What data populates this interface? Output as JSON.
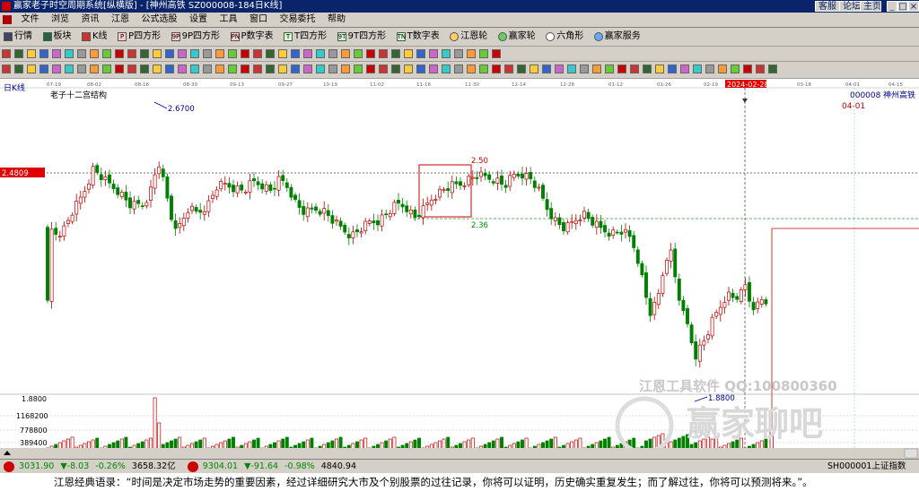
{
  "titlebar": {
    "title": "赢家老子时空周期系统[纵横版] - [神州高铁  SZ000008-184日K线]",
    "buttons": [
      "客服",
      "论坛",
      "主页"
    ],
    "win_controls": [
      "_",
      "□",
      "×"
    ]
  },
  "menu": [
    "文件",
    "浏览",
    "资讯",
    "江恩",
    "公式选股",
    "设置",
    "工具",
    "窗口",
    "交易委托",
    "帮助"
  ],
  "toolbar1": [
    {
      "icon": "grid-icon",
      "label": "行情"
    },
    {
      "icon": "blocks-icon",
      "label": "板块"
    },
    {
      "icon": "k-icon",
      "label": "K线"
    },
    {
      "icon": "p-square-icon",
      "label": "P四方形"
    },
    {
      "icon": "9p-square-icon",
      "label": "9P四方形"
    },
    {
      "icon": "p-number-icon",
      "label": "P数字表"
    },
    {
      "icon": "t-square-icon",
      "label": "T四方形"
    },
    {
      "icon": "9t-square-icon",
      "label": "9T四方形"
    },
    {
      "icon": "t-number-icon",
      "label": "T数字表"
    },
    {
      "icon": "gann-wheel-icon",
      "label": "江恩轮"
    },
    {
      "icon": "winner-wheel-icon",
      "label": "赢家轮"
    },
    {
      "icon": "hexagon-icon",
      "label": "六角形"
    },
    {
      "icon": "service-icon",
      "label": "赢家服务"
    }
  ],
  "period_label": "日K线",
  "chart_title": "老子十二宫结构",
  "stock_code": "000008",
  "stock_name": "神州高铁",
  "cursor_price_tag": "2.4809",
  "cursor_date_tag": "2024-02-28",
  "right_date_label": "04-01",
  "colors": {
    "up": "#c00000",
    "down": "#008000",
    "title_bar": "#0a246a"
  },
  "status": {
    "sh_index": "3031.90",
    "sh_change": "▼-8.03",
    "sh_pct": "-0.26%",
    "sh_amount": "3658.32亿",
    "sz_index": "9304.01",
    "sz_change": "▼-91.64",
    "sz_pct": "-0.98%",
    "sz_amount": "4840.94",
    "right": "SH000001上证指数"
  },
  "quote": "江恩经典语录：“时间是决定市场走势的重要因素，经过详细研究大市及个别股票的过往记录，你将可以证明，历史确实重复发生；而了解过往，你将可以预测将来。”。",
  "watermark": {
    "text1": "江恩工具软件  QQ:100800360",
    "text2": "赢家聊吧"
  },
  "chart_data": {
    "type": "candlestick",
    "x_ticks": [
      "07-19",
      "08-02",
      "08-16",
      "08-30",
      "09-13",
      "09-27",
      "10-19",
      "11-02",
      "11-16",
      "11-30",
      "12-14",
      "12-28",
      "01-12",
      "01-26",
      "02-19",
      "2024-02-28",
      "03-18",
      "04-01",
      "04-15"
    ],
    "y_markers": [
      "2.6700",
      "2.50",
      "2.36",
      "1.8800"
    ],
    "volume_ticks": [
      "1.8800",
      "1168200",
      "778800",
      "389400"
    ],
    "summary": {
      "high": 2.67,
      "low": 1.88,
      "box_high": 2.5,
      "box_low": 2.36
    }
  }
}
